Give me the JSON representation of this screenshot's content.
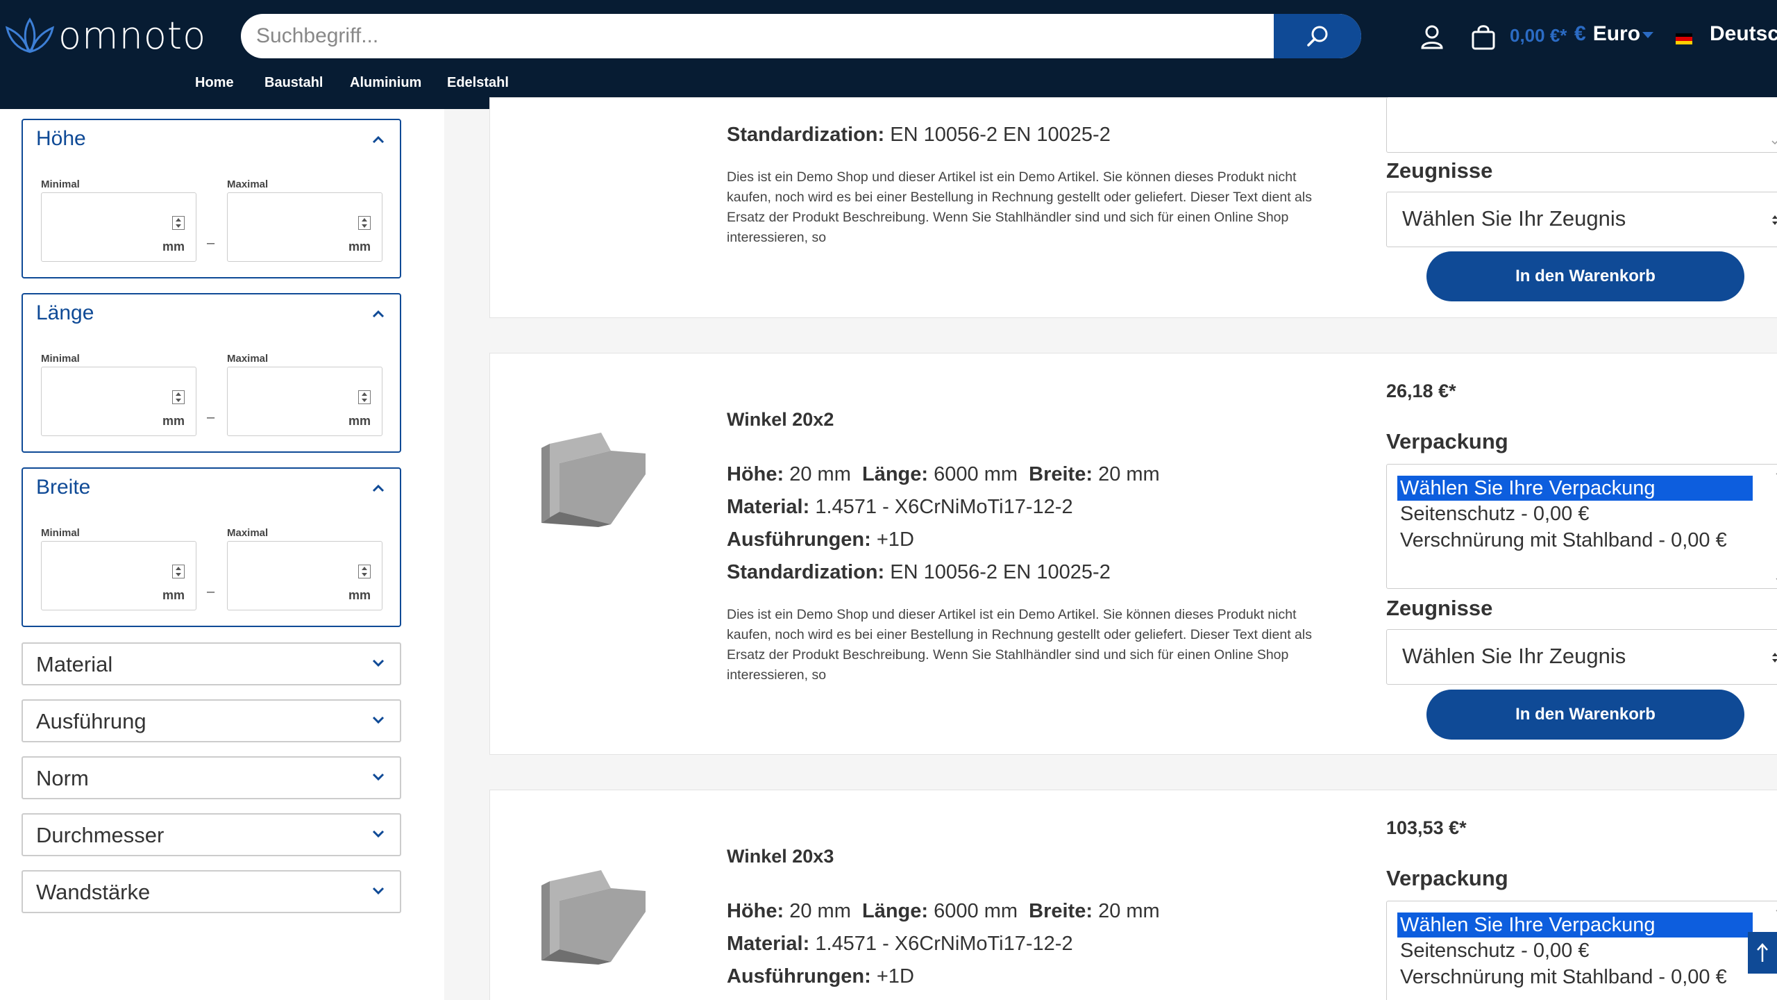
{
  "header": {
    "logo_text": "omnoto",
    "search_placeholder": "Suchbegriff...",
    "cart_total": "0,00 €*",
    "currency_symbol": "€",
    "currency_label": "Euro",
    "language": "Deutsch",
    "nav": [
      "Home",
      "Baustahl",
      "Aluminium",
      "Edelstahl"
    ]
  },
  "filters": {
    "hoehe": {
      "title": "Höhe",
      "min_label": "Minimal",
      "max_label": "Maximal",
      "unit": "mm"
    },
    "laenge": {
      "title": "Länge",
      "min_label": "Minimal",
      "max_label": "Maximal",
      "unit": "mm"
    },
    "breite": {
      "title": "Breite",
      "min_label": "Minimal",
      "max_label": "Maximal",
      "unit": "mm"
    },
    "collapsed": [
      "Material",
      "Ausführung",
      "Norm",
      "Durchmesser",
      "Wandstärke"
    ]
  },
  "labels": {
    "hoehe": "Höhe:",
    "laenge": "Länge:",
    "breite": "Breite:",
    "material": "Material:",
    "ausfuehrungen": "Ausführungen:",
    "standardization": "Standardization:",
    "verpackung": "Verpackung",
    "zeugnisse": "Zeugnisse",
    "zeugnis_select": "Wählen Sie Ihr Zeugnis",
    "cart_button": "In den Warenkorb"
  },
  "products": [
    {
      "standardization": "EN 10056-2 EN 10025-2",
      "description": "Dies ist ein Demo Shop und dieser Artikel ist ein Demo Artikel. Sie können dieses Produkt nicht kaufen, noch wird es bei einer Bestellung in Rechnung gestellt oder geliefert. Dieser Text dient als Ersatz der Produkt Beschreibung. Wenn Sie Stahlhändler sind und sich für einen Online Shop interessieren, so"
    },
    {
      "title": "Winkel 20x2",
      "price": "26,18 €*",
      "hoehe": "20 mm",
      "laenge": "6000 mm",
      "breite": "20 mm",
      "material": "1.4571 - X6CrNiMoTi17-12-2",
      "ausfuehrungen": "+1D",
      "standardization": "EN 10056-2 EN 10025-2",
      "description": "Dies ist ein Demo Shop und dieser Artikel ist ein Demo Artikel. Sie können dieses Produkt nicht kaufen, noch wird es bei einer Bestellung in Rechnung gestellt oder geliefert. Dieser Text dient als Ersatz der Produkt Beschreibung. Wenn Sie Stahlhändler sind und sich für einen Online Shop interessieren, so",
      "verpackung_options": [
        "Wählen Sie Ihre Verpackung",
        "Seitenschutz - 0,00 €",
        "Verschnürung mit Stahlband - 0,00 €"
      ]
    },
    {
      "title": "Winkel 20x3",
      "price": "103,53 €*",
      "hoehe": "20 mm",
      "laenge": "6000 mm",
      "breite": "20 mm",
      "material": "1.4571 - X6CrNiMoTi17-12-2",
      "ausfuehrungen": "+1D",
      "verpackung_options": [
        "Wählen Sie Ihre Verpackung",
        "Seitenschutz - 0,00 €",
        "Verschnürung mit Stahlband - 0,00 €"
      ]
    }
  ],
  "colors": {
    "header_bg": "#071c33",
    "primary": "#0f4a96",
    "accent": "#2b6bc4",
    "selected_option": "#0d5ede"
  }
}
